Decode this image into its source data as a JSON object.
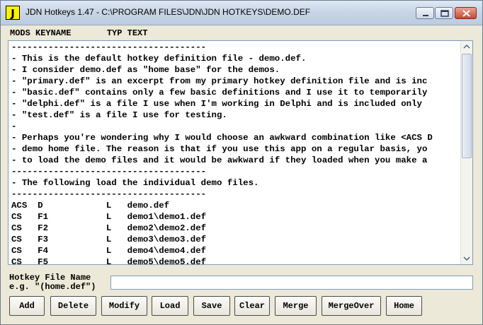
{
  "window": {
    "title": "JDN Hotkeys 1.47  -  C:\\PROGRAM FILES\\JDN\\JDN HOTKEYS\\DEMO.DEF",
    "icon_letter": "J",
    "controls": [
      "minimize-icon",
      "maximize-icon",
      "close-icon"
    ]
  },
  "columns_header": "MODS KEYNAME       TYP TEXT",
  "editor": {
    "lines": [
      "-------------------------------------",
      "- This is the default hotkey definition file - demo.def.",
      "- I consider demo.def as \"home base\" for the demos.",
      "- \"primary.def\" is an excerpt from my primary hotkey definition file and is inc",
      "- \"basic.def\" contains only a few basic definitions and I use it to temporarily",
      "- \"delphi.def\" is a file I use when I'm working in Delphi and is included only ",
      "- \"test.def\" is a file I use for testing.",
      "-",
      "- Perhaps you're wondering why I would choose an awkward combination like <ACS D",
      "- demo home file. The reason is that if you use this app on a regular basis, yo",
      "- to load the demo files and it would be awkward if they loaded when you make a",
      "-------------------------------------",
      "- The following load the individual demo files.",
      "-------------------------------------",
      "ACS  D            L   demo.def",
      "CS   F1           L   demo1\\demo1.def",
      "CS   F2           L   demo2\\demo2.def",
      "CS   F3           L   demo3\\demo3.def",
      "CS   F4           L   demo4\\demo4.def",
      "CS   F5           L   demo5\\demo5.def"
    ]
  },
  "hotkey_file": {
    "label_line1": "Hotkey File Name",
    "label_line2": "e.g. \"(home.def\")",
    "value": ""
  },
  "buttons": [
    {
      "label": "Add"
    },
    {
      "label": "Delete"
    },
    {
      "label": "Modify"
    },
    {
      "label": "Load"
    },
    {
      "label": "Save"
    },
    {
      "label": "Clear"
    },
    {
      "label": "Merge"
    },
    {
      "label": "MergeOver"
    },
    {
      "label": "Home"
    }
  ],
  "colors": {
    "titlebar_top": "#dfe8f3",
    "window_bg": "#ece9d8",
    "icon_bg": "#fff200",
    "close_button": "#c64a35"
  }
}
